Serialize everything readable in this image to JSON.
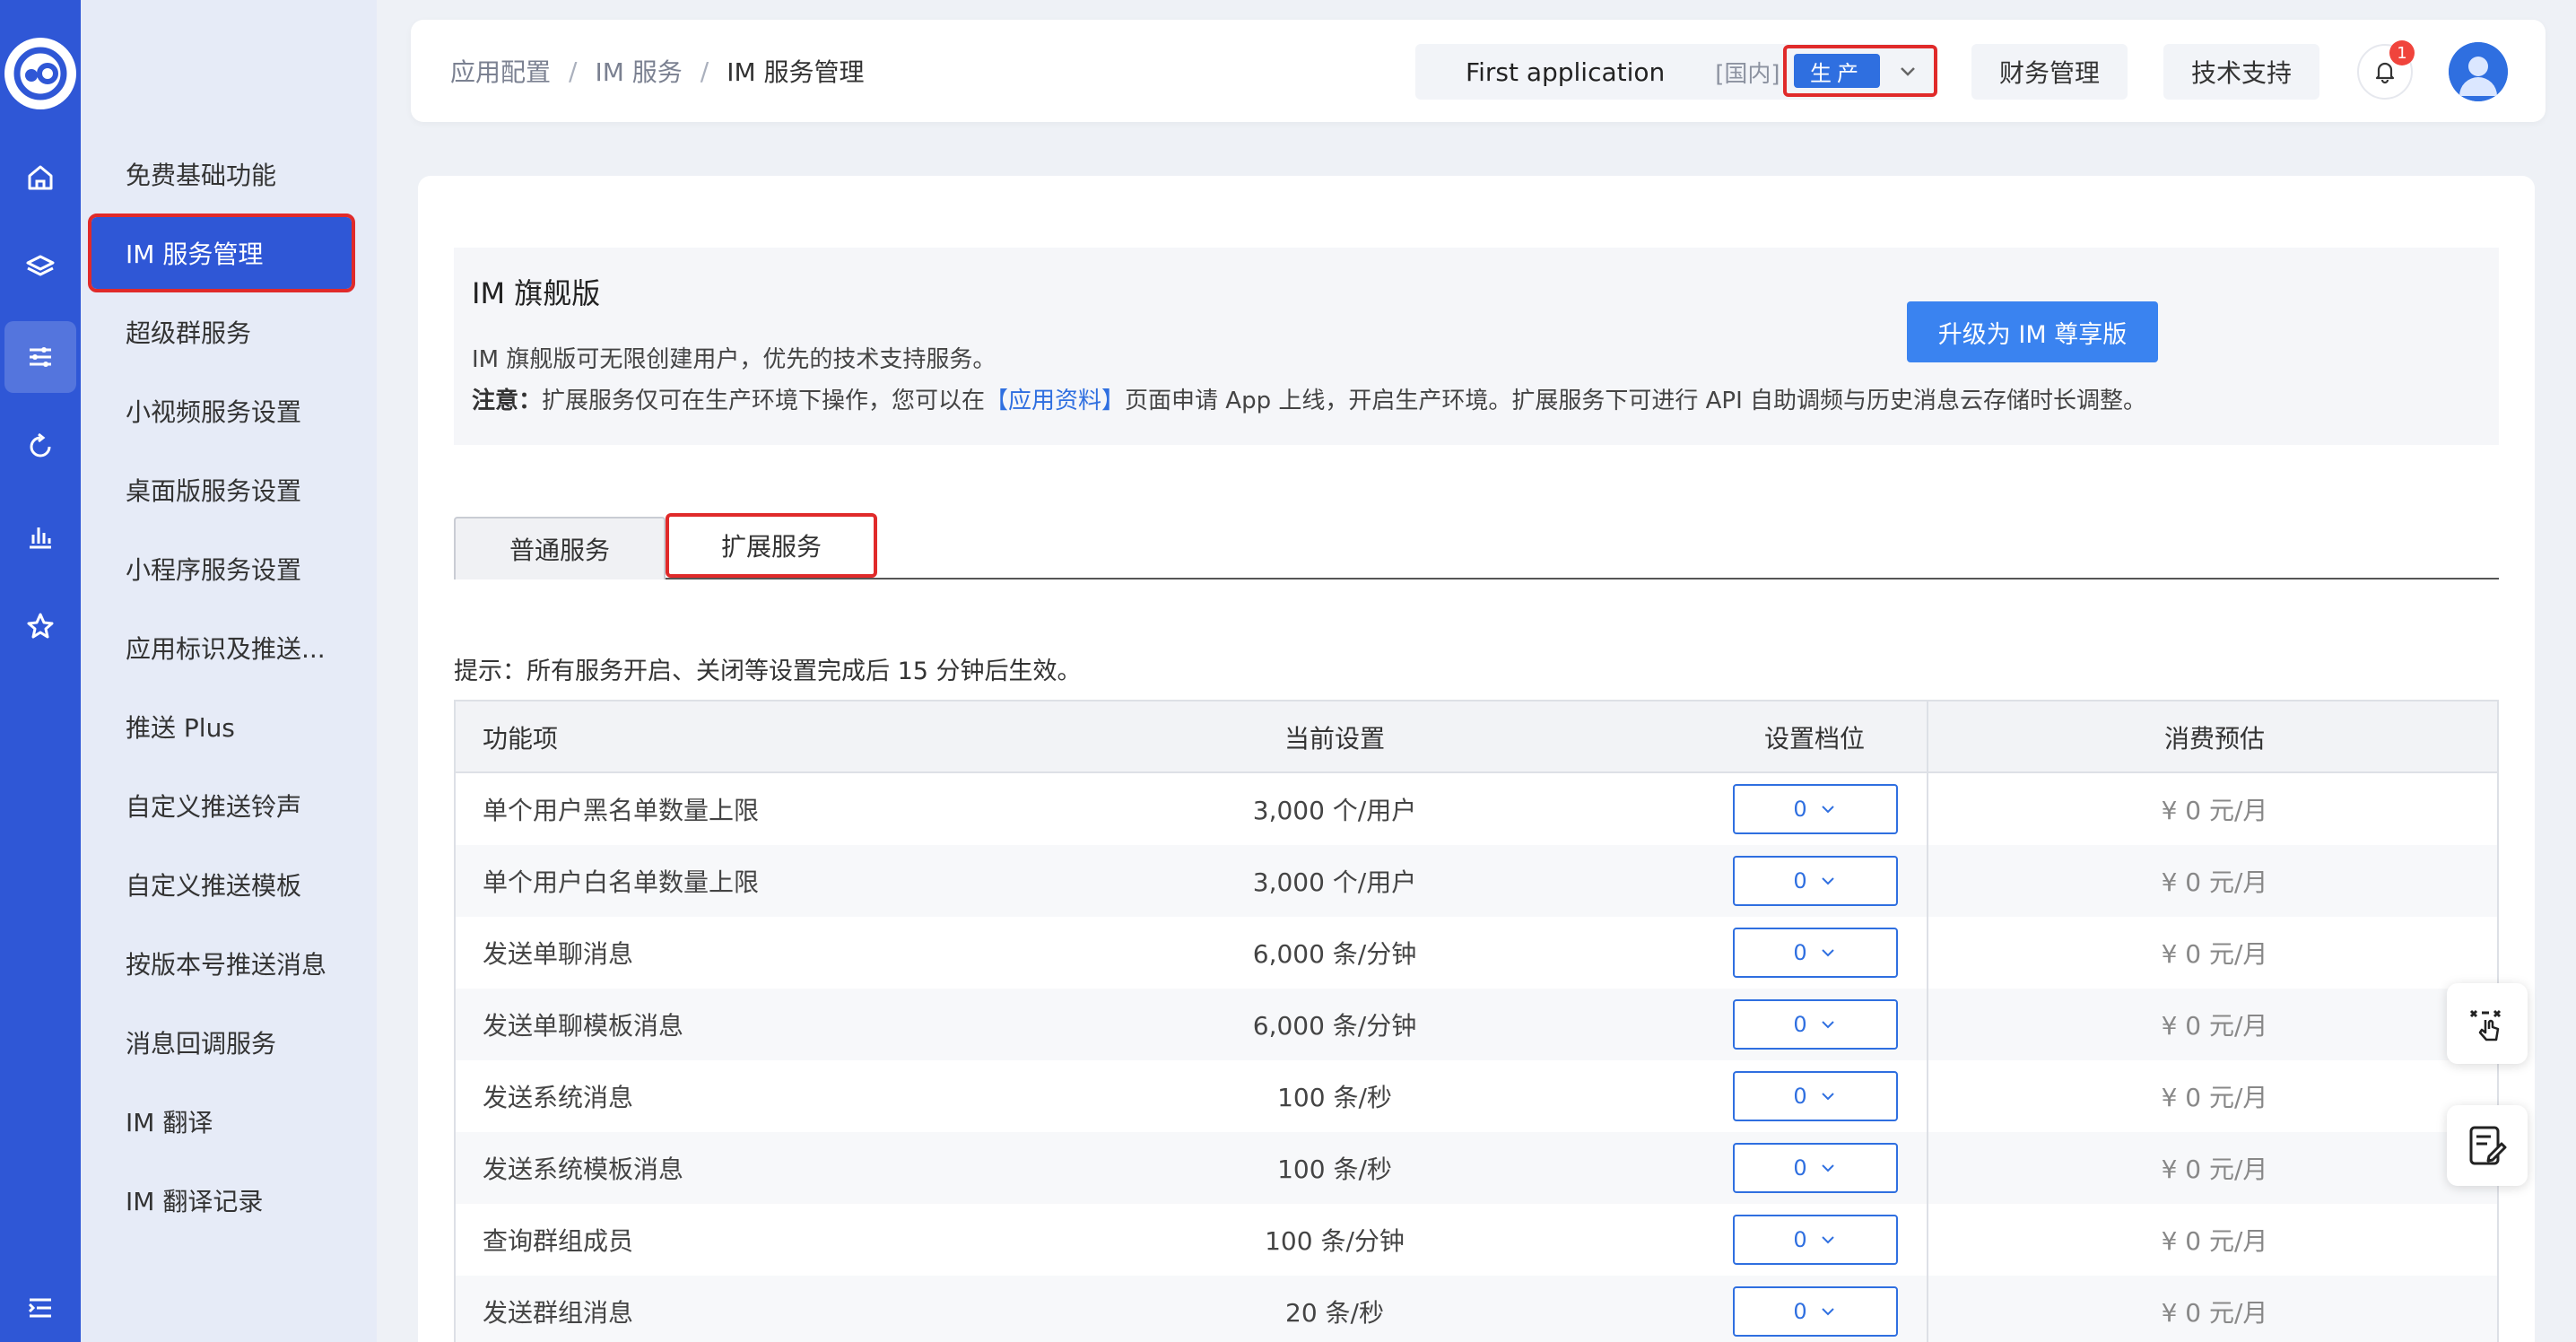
{
  "sidebar": {
    "items": [
      {
        "label": "免费基础功能",
        "active": false
      },
      {
        "label": "IM 服务管理",
        "active": true
      },
      {
        "label": "超级群服务",
        "active": false
      },
      {
        "label": "小视频服务设置",
        "active": false
      },
      {
        "label": "桌面版服务设置",
        "active": false
      },
      {
        "label": "小程序服务设置",
        "active": false
      },
      {
        "label": "应用标识及推送...",
        "active": false
      },
      {
        "label": "推送 Plus",
        "active": false
      },
      {
        "label": "自定义推送铃声",
        "active": false
      },
      {
        "label": "自定义推送模板",
        "active": false
      },
      {
        "label": "按版本号推送消息",
        "active": false
      },
      {
        "label": "消息回调服务",
        "active": false
      },
      {
        "label": "IM 翻译",
        "active": false
      },
      {
        "label": "IM 翻译记录",
        "active": false
      }
    ]
  },
  "header": {
    "breadcrumb": [
      "应用配置",
      "IM 服务",
      "IM 服务管理"
    ],
    "app_name": "First application",
    "region": "[国内]",
    "env": "生产",
    "finance_label": "财务管理",
    "support_label": "技术支持",
    "notification_count": "1"
  },
  "banner": {
    "title": "IM 旗舰版",
    "desc": "IM 旗舰版可无限创建用户，优先的技术支持服务。",
    "note_label": "注意：",
    "note_pre": "扩展服务仅可在生产环境下操作，您可以在",
    "note_link": "【应用资料】",
    "note_post": "页面申请 App 上线，开启生产环境。扩展服务下可进行 API 自助调频与历史消息云存储时长调整。",
    "upgrade_label": "升级为 IM 尊享版"
  },
  "tabs": {
    "basic": "普通服务",
    "extended": "扩展服务"
  },
  "tip": "提示：所有服务开启、关闭等设置完成后 15 分钟后生效。",
  "table": {
    "headers": {
      "feature": "功能项",
      "current": "当前设置",
      "tier": "设置档位",
      "cost": "消费预估"
    },
    "rows": [
      {
        "feature": "单个用户黑名单数量上限",
        "current": "3,000 个/用户",
        "tier": "0",
        "cost": "¥ 0 元/月"
      },
      {
        "feature": "单个用户白名单数量上限",
        "current": "3,000 个/用户",
        "tier": "0",
        "cost": "¥ 0 元/月"
      },
      {
        "feature": "发送单聊消息",
        "current": "6,000 条/分钟",
        "tier": "0",
        "cost": "¥ 0 元/月"
      },
      {
        "feature": "发送单聊模板消息",
        "current": "6,000 条/分钟",
        "tier": "0",
        "cost": "¥ 0 元/月"
      },
      {
        "feature": "发送系统消息",
        "current": "100 条/秒",
        "tier": "0",
        "cost": "¥ 0 元/月"
      },
      {
        "feature": "发送系统模板消息",
        "current": "100 条/秒",
        "tier": "0",
        "cost": "¥ 0 元/月"
      },
      {
        "feature": "查询群组成员",
        "current": "100 条/分钟",
        "tier": "0",
        "cost": "¥ 0 元/月"
      },
      {
        "feature": "发送群组消息",
        "current": "20 条/秒",
        "tier": "0",
        "cost": "¥ 0 元/月"
      }
    ]
  },
  "colors": {
    "brand": "#2f57d6",
    "accent": "#2f6fe0",
    "highlight": "#e02a2a"
  }
}
